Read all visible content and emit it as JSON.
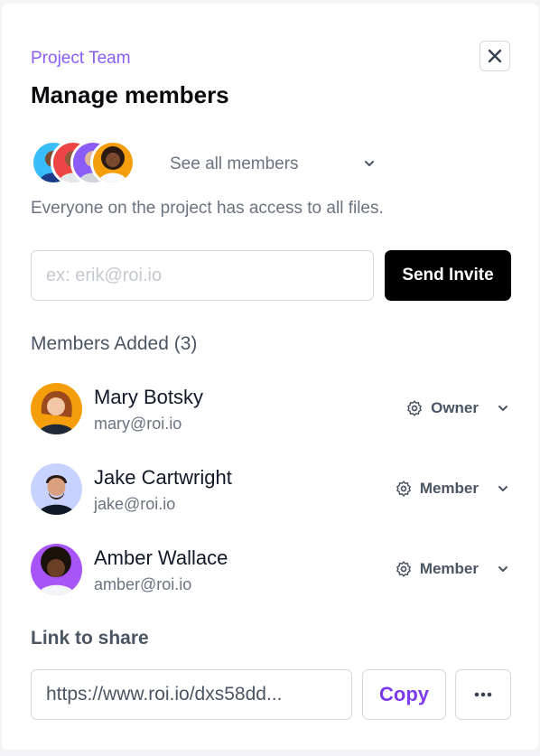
{
  "header": {
    "eyebrow": "Project Team",
    "title": "Manage members",
    "close_icon": "close-icon"
  },
  "summary": {
    "see_all_label": "See all members",
    "access_note": "Everyone on the project has access to all files.",
    "avatar_colors": [
      "#38bdf8",
      "#ef4444",
      "#8b5cf6",
      "#f59e0b"
    ]
  },
  "invite": {
    "placeholder": "ex: erik@roi.io",
    "value": "",
    "button_label": "Send Invite"
  },
  "members_section": {
    "title": "Members Added (3)",
    "members": [
      {
        "name": "Mary Botsky",
        "email": "mary@roi.io",
        "role": "Owner",
        "avatar_color": "#f59e0b"
      },
      {
        "name": "Jake Cartwright",
        "email": "jake@roi.io",
        "role": "Member",
        "avatar_color": "#a5b4fc"
      },
      {
        "name": "Amber Wallace",
        "email": "amber@roi.io",
        "role": "Member",
        "avatar_color": "#a855f7"
      }
    ]
  },
  "share": {
    "label": "Link to share",
    "link_value": "https://www.roi.io/dxs58dd...",
    "copy_label": "Copy",
    "more_icon": "more-horizontal-icon"
  },
  "colors": {
    "accent": "#8b5cf6",
    "copy_text": "#7c3aed",
    "primary_button": "#000000",
    "border": "#d5d8de"
  }
}
